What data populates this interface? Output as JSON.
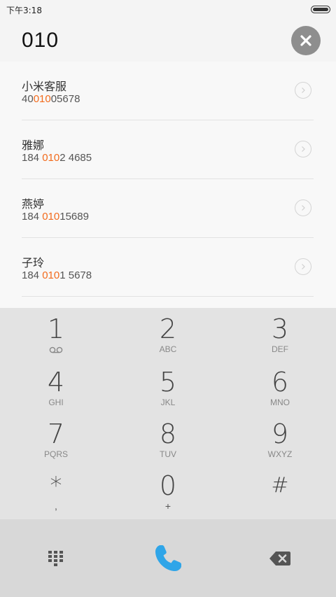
{
  "status_bar": {
    "time": "下午3:18"
  },
  "dialer": {
    "input_value": "010"
  },
  "results": [
    {
      "name": "小米客服",
      "number_pre": "40",
      "number_match": "010",
      "number_post": "05678"
    },
    {
      "name": "雅娜",
      "number_pre": "184 ",
      "number_match": "010",
      "number_post": "2 4685"
    },
    {
      "name": "燕婷",
      "number_pre": "184 ",
      "number_match": "010",
      "number_post": "15689"
    },
    {
      "name": "子玲",
      "number_pre": "184 ",
      "number_match": "010",
      "number_post": "1 5678"
    }
  ],
  "keypad": {
    "keys": [
      {
        "digit": "1",
        "letters": ""
      },
      {
        "digit": "2",
        "letters": "ABC"
      },
      {
        "digit": "3",
        "letters": "DEF"
      },
      {
        "digit": "4",
        "letters": "GHI"
      },
      {
        "digit": "5",
        "letters": "JKL"
      },
      {
        "digit": "6",
        "letters": "MNO"
      },
      {
        "digit": "7",
        "letters": "PQRS"
      },
      {
        "digit": "8",
        "letters": "TUV"
      },
      {
        "digit": "9",
        "letters": "WXYZ"
      },
      {
        "digit": "*",
        "letters": ","
      },
      {
        "digit": "0",
        "letters": "+"
      },
      {
        "digit": "#",
        "letters": ""
      }
    ]
  },
  "colors": {
    "accent": "#f26b1d",
    "call": "#2fa5e8",
    "clear_button": "#8e8e8e"
  },
  "icons": [
    "voicemail-icon",
    "keypad-toggle-icon",
    "phone-icon",
    "backspace-icon",
    "close-icon",
    "chevron-right-icon"
  ]
}
